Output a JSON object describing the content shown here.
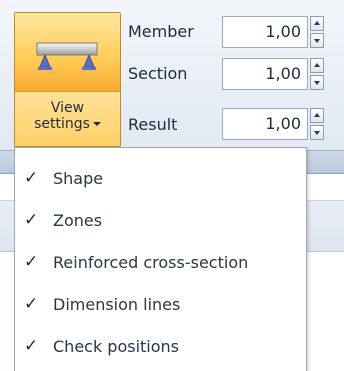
{
  "view_settings": {
    "label_line1": "View",
    "label_line2": "settings",
    "icon": "beam-support-icon"
  },
  "params": [
    {
      "label": "Member",
      "value": "1,00"
    },
    {
      "label": "Section",
      "value": "1,00"
    },
    {
      "label": "Result",
      "value": "1,00"
    }
  ],
  "menu": {
    "items": [
      {
        "label": "Shape",
        "checked": true
      },
      {
        "label": "Zones",
        "checked": true
      },
      {
        "label": "Reinforced cross-section",
        "checked": true
      },
      {
        "label": "Dimension lines",
        "checked": true
      },
      {
        "label": "Check positions",
        "checked": true
      }
    ],
    "check_glyph": "✓"
  },
  "colors": {
    "button_highlight": "#ffd46a",
    "button_border": "#c28a28",
    "support_blue": "#5b6fc9"
  }
}
